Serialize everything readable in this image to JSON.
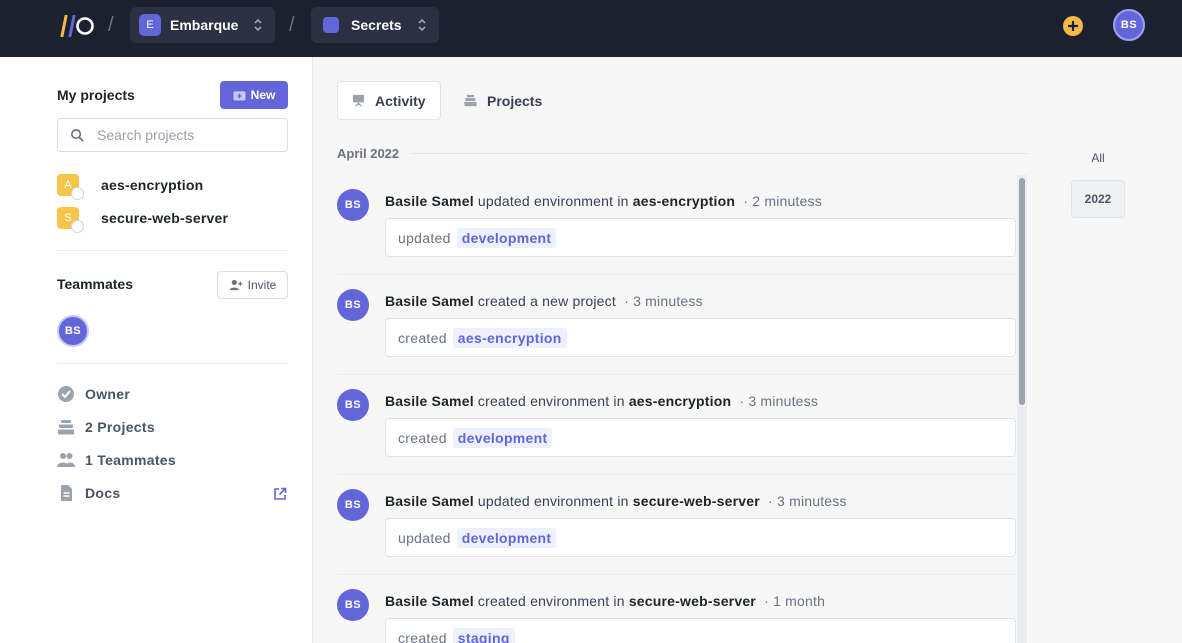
{
  "topbar": {
    "org": {
      "badge": "E",
      "name": "Embarque"
    },
    "section": {
      "name": "Secrets"
    },
    "separator": "/",
    "user_initials": "BS"
  },
  "sidebar": {
    "projects_title": "My projects",
    "new_label": "New",
    "search_placeholder": "Search projects",
    "projects": [
      {
        "initial": "A",
        "name": "aes-encryption"
      },
      {
        "initial": "S",
        "name": "secure-web-server"
      }
    ],
    "teammates_title": "Teammates",
    "invite_label": "Invite",
    "teammate_initials": "BS",
    "meta": {
      "role": "Owner",
      "projects": "2 Projects",
      "teammates": "1 Teammates",
      "docs": "Docs"
    }
  },
  "tabs": {
    "activity": "Activity",
    "projects": "Projects"
  },
  "feed": {
    "month": "April 2022",
    "items": [
      {
        "initials": "BS",
        "user": "Basile Samel",
        "action": "updated environment in",
        "target": "aes-encryption",
        "time": "2 minutess",
        "verb": "updated",
        "tag": "development"
      },
      {
        "initials": "BS",
        "user": "Basile Samel",
        "action": "created a new project",
        "target": "",
        "time": "3 minutess",
        "verb": "created",
        "tag": "aes-encryption"
      },
      {
        "initials": "BS",
        "user": "Basile Samel",
        "action": "created environment in",
        "target": "aes-encryption",
        "time": "3 minutess",
        "verb": "created",
        "tag": "development"
      },
      {
        "initials": "BS",
        "user": "Basile Samel",
        "action": "updated environment in",
        "target": "secure-web-server",
        "time": "3 minutess",
        "verb": "updated",
        "tag": "development"
      },
      {
        "initials": "BS",
        "user": "Basile Samel",
        "action": "created environment in",
        "target": "secure-web-server",
        "time": "1 month",
        "verb": "created",
        "tag": "staging"
      }
    ]
  },
  "years": {
    "all": "All",
    "current": "2022"
  },
  "colors": {
    "accent": "#6366d8",
    "topbar": "#1c2130",
    "project_icon": "#f5c54a",
    "add_button": "#f2b948"
  }
}
